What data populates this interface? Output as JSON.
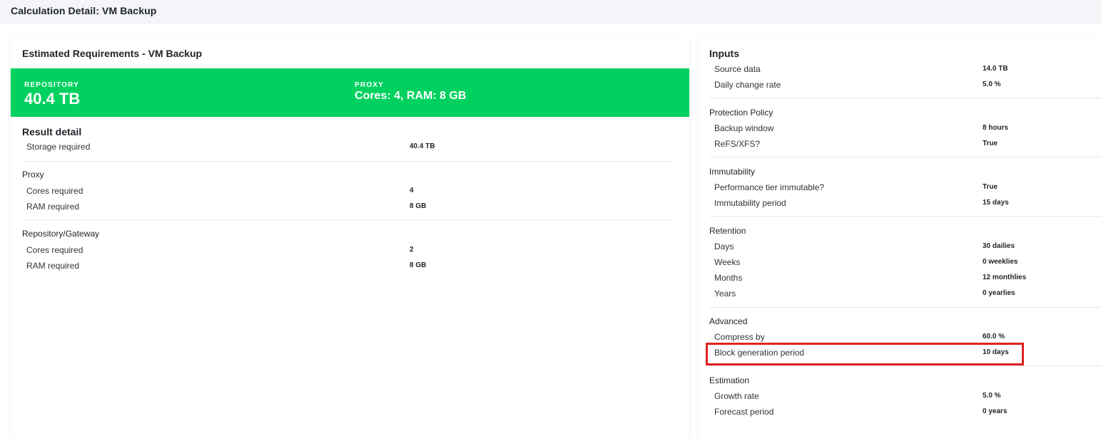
{
  "header": {
    "title": "Calculation Detail: VM Backup"
  },
  "left": {
    "card_title": "Estimated Requirements - VM Backup",
    "banner": {
      "repository_label": "REPOSITORY",
      "repository_value": "40.4 TB",
      "proxy_label": "PROXY",
      "proxy_value": "Cores: 4, RAM: 8 GB",
      "color": "#00d15f"
    },
    "result_title": "Result detail",
    "storage": {
      "label": "Storage required",
      "value": "40.4 TB"
    },
    "proxy": {
      "label": "Proxy",
      "rows": [
        {
          "label": "Cores required",
          "value": "4"
        },
        {
          "label": "RAM required",
          "value": "8 GB"
        }
      ]
    },
    "repository_gateway": {
      "label": "Repository/Gateway",
      "rows": [
        {
          "label": "Cores required",
          "value": "2"
        },
        {
          "label": "RAM required",
          "value": "8 GB"
        }
      ]
    }
  },
  "right": {
    "title": "Inputs",
    "inputs": [
      {
        "label": "Source data",
        "value": "14.0 TB"
      },
      {
        "label": "Daily change rate",
        "value": "5.0 %"
      }
    ],
    "protection_policy": {
      "label": "Protection Policy",
      "rows": [
        {
          "label": "Backup window",
          "value": "8 hours"
        },
        {
          "label": "ReFS/XFS?",
          "value": "True"
        }
      ]
    },
    "immutability": {
      "label": "Immutability",
      "rows": [
        {
          "label": "Performance tier immutable?",
          "value": "True"
        },
        {
          "label": "Immutability period",
          "value": "15 days"
        }
      ]
    },
    "retention": {
      "label": "Retention",
      "rows": [
        {
          "label": "Days",
          "value": "30 dailies"
        },
        {
          "label": "Weeks",
          "value": "0 weeklies"
        },
        {
          "label": "Months",
          "value": "12 monthlies"
        },
        {
          "label": "Years",
          "value": "0 yearlies"
        }
      ]
    },
    "advanced": {
      "label": "Advanced",
      "rows": [
        {
          "label": "Compress by",
          "value": "60.0 %"
        },
        {
          "label": "Block generation period",
          "value": "10 days"
        }
      ]
    },
    "estimation": {
      "label": "Estimation",
      "rows": [
        {
          "label": "Growth rate",
          "value": "5.0 %"
        },
        {
          "label": "Forecast period",
          "value": "0 years"
        }
      ]
    }
  },
  "highlight_color": "#e02020"
}
